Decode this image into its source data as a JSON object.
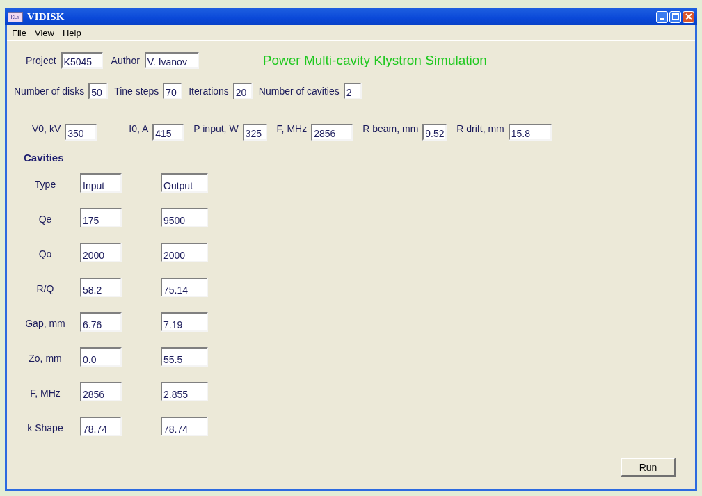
{
  "window": {
    "title": "VIDISK",
    "icon_text": "KLY"
  },
  "menu": [
    "File",
    "View",
    "Help"
  ],
  "header": {
    "fields": [
      {
        "label": "Project",
        "value": "K5045"
      },
      {
        "label": "Author",
        "value": "V. Ivanov"
      }
    ],
    "title": "Power Multi-cavity Klystron Simulation"
  },
  "settings": [
    {
      "label": "Number of disks",
      "value": "50"
    },
    {
      "label": "Tine steps",
      "value": "70"
    },
    {
      "label": "Iterations",
      "value": "20"
    },
    {
      "label": "Number of cavities",
      "value": "2"
    }
  ],
  "beam": [
    {
      "label": "V0, kV",
      "value": "350"
    },
    {
      "label": "I0, A",
      "value": "415"
    },
    {
      "label": "P input, W",
      "value": "325"
    },
    {
      "label": "F, MHz",
      "value": "2856"
    },
    {
      "label": "R beam, mm",
      "value": "9.52"
    },
    {
      "label": "R drift, mm",
      "value": "15.8"
    }
  ],
  "cavities": {
    "heading": "Cavities",
    "rows": [
      {
        "label": "Type",
        "values": [
          "Input",
          "Output"
        ]
      },
      {
        "label": "Qe",
        "values": [
          "175",
          "9500"
        ]
      },
      {
        "label": "Qo",
        "values": [
          "2000",
          "2000"
        ]
      },
      {
        "label": "R/Q",
        "values": [
          "58.2",
          "75.14"
        ]
      },
      {
        "label": "Gap, mm",
        "values": [
          "6.76",
          "7.19"
        ]
      },
      {
        "label": "Zo, mm",
        "values": [
          "0.0",
          "55.5"
        ]
      },
      {
        "label": "F, MHz",
        "values": [
          "2856",
          "2.855"
        ]
      },
      {
        "label": "k Shape",
        "values": [
          "78.74",
          "78.74"
        ]
      }
    ]
  },
  "run_button": "Run"
}
